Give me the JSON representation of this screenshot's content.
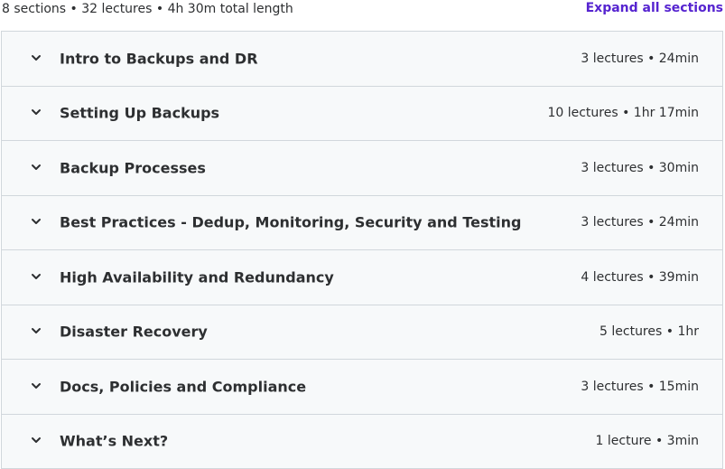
{
  "header": {
    "summary": "8 sections • 32 lectures • 4h 30m total length",
    "expand_all_label": "Expand all sections"
  },
  "colors": {
    "link": "#5624d0",
    "row_background": "#f7f9fa",
    "border": "#d1d7dc",
    "text": "#2d2f31"
  },
  "sections": [
    {
      "title": "Intro to Backups and DR",
      "meta": "3 lectures • 24min",
      "icon": "chevron-down-icon"
    },
    {
      "title": "Setting Up Backups",
      "meta": "10 lectures • 1hr 17min",
      "icon": "chevron-down-icon"
    },
    {
      "title": "Backup Processes",
      "meta": "3 lectures • 30min",
      "icon": "chevron-down-icon"
    },
    {
      "title": "Best Practices - Dedup, Monitoring, Security and Testing",
      "meta": "3 lectures • 24min",
      "icon": "chevron-down-icon"
    },
    {
      "title": "High Availability and Redundancy",
      "meta": "4 lectures • 39min",
      "icon": "chevron-down-icon"
    },
    {
      "title": "Disaster Recovery",
      "meta": "5 lectures • 1hr",
      "icon": "chevron-down-icon"
    },
    {
      "title": "Docs, Policies and Compliance",
      "meta": "3 lectures • 15min",
      "icon": "chevron-down-icon"
    },
    {
      "title": "What’s Next?",
      "meta": "1 lecture • 3min",
      "icon": "chevron-down-icon"
    }
  ]
}
